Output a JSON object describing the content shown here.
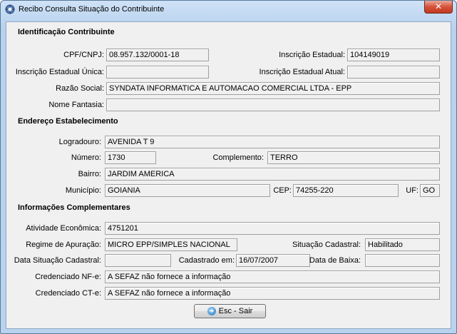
{
  "window": {
    "title": "Recibo Consulta Situação do Contribuinte",
    "close_label": "✕"
  },
  "identificacao": {
    "section_title": "Identificação Contribuinte",
    "cpf_cnpj_label": "CPF/CNPJ:",
    "cpf_cnpj": "08.957.132/0001-18",
    "inscricao_estadual_label": "Inscrição Estadual:",
    "inscricao_estadual": "104149019",
    "inscricao_unica_label": "Inscrição Estadual Única:",
    "inscricao_unica": "",
    "inscricao_atual_label": "Inscrição Estadual Atual:",
    "inscricao_atual": "",
    "razao_social_label": "Razão Social:",
    "razao_social": "SYNDATA INFORMATICA E AUTOMACAO COMERCIAL LTDA - EPP",
    "nome_fantasia_label": "Nome Fantasia:",
    "nome_fantasia": ""
  },
  "endereco": {
    "section_title": "Endereço Estabelecimento",
    "logradouro_label": "Logradouro:",
    "logradouro": "AVENIDA T 9",
    "numero_label": "Número:",
    "numero": "1730",
    "complemento_label": "Complemento:",
    "complemento": "TERRO",
    "bairro_label": "Bairro:",
    "bairro": "JARDIM AMERICA",
    "municipio_label": "Município:",
    "municipio": "GOIANIA",
    "cep_label": "CEP:",
    "cep": "74255-220",
    "uf_label": "UF:",
    "uf": "GO"
  },
  "complementares": {
    "section_title": "Informações Complementares",
    "atividade_label": "Atividade Econômica:",
    "atividade": "4751201",
    "regime_label": "Regime de Apuração:",
    "regime": "MICRO EPP/SIMPLES NACIONAL",
    "situacao_label": "Situação Cadastral:",
    "situacao": "Habilitado",
    "data_situacao_label": "Data Situação Cadastral:",
    "data_situacao": "",
    "cadastrado_label": "Cadastrado em:",
    "cadastrado": "16/07/2007",
    "data_baixa_label": "Data de Baixa:",
    "data_baixa": "",
    "nfe_label": "Credenciado NF-e:",
    "nfe": "A SEFAZ não fornece a informação",
    "cte_label": "Credenciado CT-e:",
    "cte": "A SEFAZ não fornece a informação"
  },
  "actions": {
    "exit_label": "Esc - Sair",
    "exit_icon": "exit-arrow-icon"
  }
}
